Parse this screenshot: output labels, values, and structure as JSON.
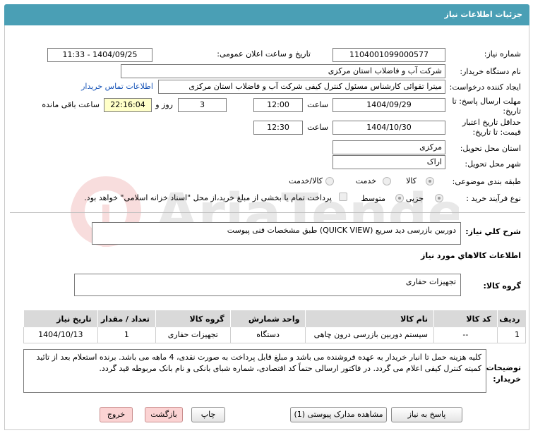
{
  "header": {
    "title": "جزئیات اطلاعات نیاز"
  },
  "form": {
    "need_number_label": "شماره نیاز:",
    "need_number": "1104001099000577",
    "announce_label": "تاریخ و ساعت اعلان عمومی:",
    "announce_value": "1404/09/25 - 11:33",
    "buyer_org_label": "نام دستگاه خریدار:",
    "buyer_org": "شرکت آب و فاضلاب استان مرکزی",
    "requester_label": "ایجاد کننده درخواست:",
    "requester": "میترا تقوائی کارشناس مسئول کنترل کیفی شرکت آب و فاضلاب استان مرکزی",
    "contact_link": "اطلاعات تماس خریدار",
    "deadline_label_1": "مهلت ارسال پاسخ: تا",
    "deadline_label_2": "تاریخ:",
    "deadline_date": "1404/09/29",
    "time_label": "ساعت",
    "deadline_time": "12:00",
    "days": "3",
    "days_label": "روز و",
    "remaining": "22:16:04",
    "remaining_label": "ساعت باقی مانده",
    "validity_label_1": "حداقل تاریخ اعتبار",
    "validity_label_2": "قیمت: تا تاریخ:",
    "validity_date": "1404/10/30",
    "validity_time": "12:30",
    "province_label": "استان محل تحویل:",
    "province": "مرکزی",
    "city_label": "شهر محل تحویل:",
    "city": "اراک",
    "category_label": "طبقه بندی موضوعی:",
    "category_options": [
      "کالا",
      "خدمت",
      "کالا/خدمت"
    ],
    "process_label": "نوع فرآیند خرید :",
    "process_options": [
      "جزیی",
      "متوسط"
    ],
    "payment_note": "پرداخت تمام یا بخشی از مبلغ خرید،از محل \"اسناد خزانه اسلامی\" خواهد بود."
  },
  "summary": {
    "label": "شرح کلي نياز:",
    "text": "دوربین بازرسی دید سریع (QUICK VIEW) طبق مشخصات فنی پیوست"
  },
  "goods": {
    "section_title": "اطلاعات کالاهاي مورد نياز",
    "group_label": "گروه کالا:",
    "group_value": "تجهیزات حفاری",
    "columns": [
      "ردیف",
      "کد کالا",
      "نام کالا",
      "واحد شمارش",
      "گروه کالا",
      "تعداد / مقدار",
      "تاریخ نیاز"
    ],
    "rows": [
      {
        "row": "1",
        "code": "--",
        "name": "سیستم دوربین بازرسی درون چاهی",
        "unit": "دستگاه",
        "group": "تجهیزات حفاری",
        "qty": "1",
        "date": "1404/10/13"
      }
    ]
  },
  "notes": {
    "label_1": "توضیحات",
    "label_2": "خریدار:",
    "text": "کلیه هزینه حمل تا انبار خریدار به عهده فروشنده می باشد و مبلغ قابل پرداخت به صورت نقدی، 4 ماهه می باشد. برنده استعلام بعد از تائید کمیته کنترل کیفی اعلام می گردد. در فاکتور ارسالی حتماً کد اقتصادی، شماره شبای بانکی و نام بانک مربوطه قید گردد."
  },
  "buttons": {
    "reply": "پاسخ به نیاز",
    "docs": "مشاهده مدارک پیوستی (1)",
    "print": "چاپ",
    "back": "بازگشت",
    "exit": "خروج"
  }
}
